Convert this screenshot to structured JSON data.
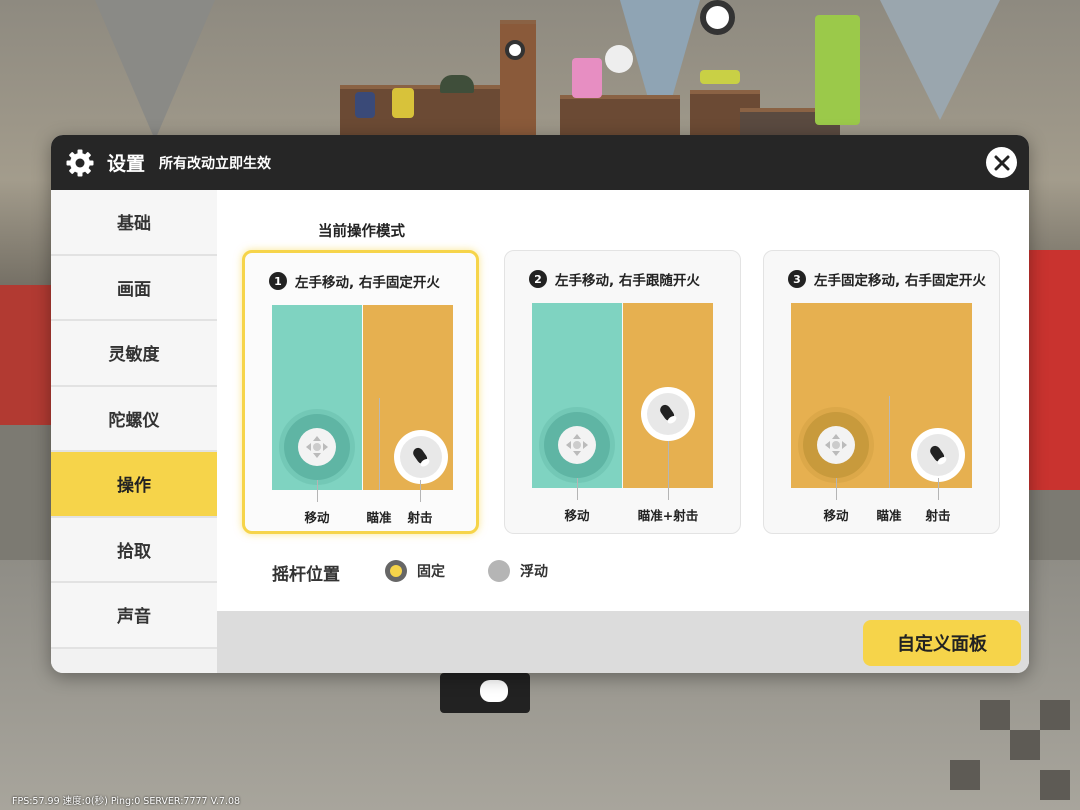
{
  "header": {
    "title": "设置",
    "subtitle": "所有改动立即生效",
    "close_icon": "close-icon",
    "gear_icon": "gear-icon"
  },
  "sidebar": {
    "items": [
      {
        "label": "基础",
        "active": false
      },
      {
        "label": "画面",
        "active": false
      },
      {
        "label": "灵敏度",
        "active": false
      },
      {
        "label": "陀螺仪",
        "active": false
      },
      {
        "label": "操作",
        "active": true
      },
      {
        "label": "拾取",
        "active": false
      },
      {
        "label": "声音",
        "active": false
      }
    ]
  },
  "main": {
    "mode_title": "当前操作模式",
    "modes": [
      {
        "number": "1",
        "label": "左手移动, 右手固定开火",
        "selected": true,
        "labels": {
          "move": "移动",
          "aim": "瞄准",
          "fire": "射击"
        }
      },
      {
        "number": "2",
        "label": "左手移动, 右手跟随开火",
        "selected": false,
        "labels": {
          "move": "移动",
          "aim_fire": "瞄准+射击"
        }
      },
      {
        "number": "3",
        "label": "左手固定移动, 右手固定开火",
        "selected": false,
        "labels": {
          "move": "移动",
          "aim": "瞄准",
          "fire": "射击"
        }
      }
    ],
    "joystick_position": {
      "label": "摇杆位置",
      "options": [
        {
          "label": "固定",
          "selected": true
        },
        {
          "label": "浮动",
          "selected": false
        }
      ]
    }
  },
  "footer": {
    "custom_button": "自定义面板"
  },
  "status_bar": "FPS:57.99 速度:0(秒) Ping:0 SERVER:7777 V.7.08",
  "colors": {
    "accent": "#f6d44a",
    "teal_zone": "#7fd3c1",
    "orange_zone": "#e6b050",
    "header_bg": "#262626"
  }
}
